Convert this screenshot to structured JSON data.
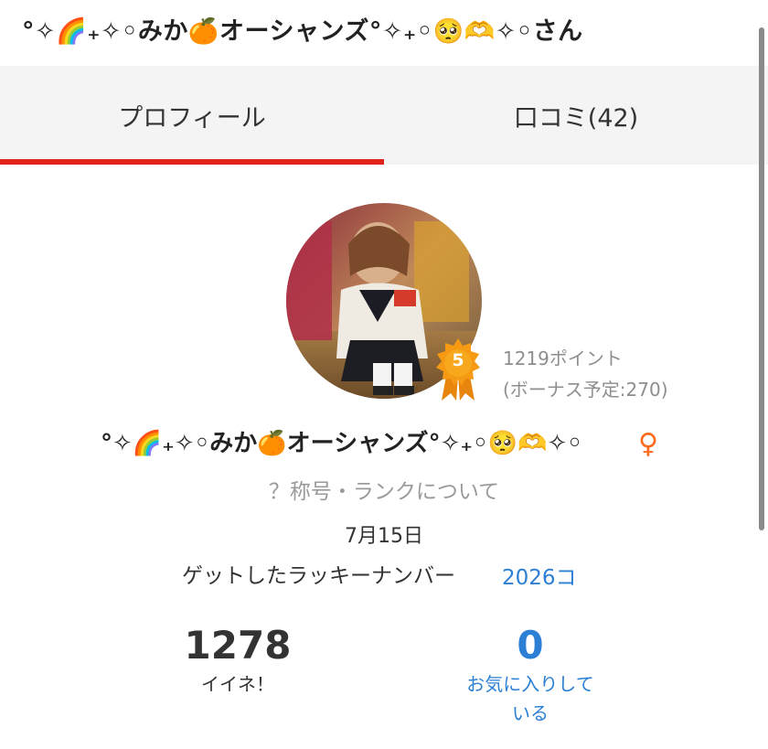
{
  "header": {
    "title": "°✧🌈₊✧◦みか🍊オーシャンズ°✧₊◦🥺🫶✧◦さん"
  },
  "tabs": [
    {
      "label": "プロフィール",
      "active": true
    },
    {
      "label": "口コミ(42)",
      "active": false
    }
  ],
  "profile": {
    "rank": "5",
    "points": "1219ポイント",
    "bonus": "(ボーナス予定:270)",
    "name": "°✧🌈₊✧◦みか🍊オーシャンズ°✧₊◦🥺🫶✧◦",
    "gender_symbol": "♀",
    "rank_link": "？称号・ランクについて",
    "lucky_date": "7月15日",
    "lucky_label": "ゲットしたラッキーナンバー",
    "lucky_count": "2026コ",
    "likes_value": "1278",
    "likes_label": "イイネ！",
    "favorites_value": "0",
    "favorites_label": "お気に入りしている"
  },
  "colors": {
    "accent_red": "#e0241b",
    "link_blue": "#2b7fd4",
    "badge_orange": "#f59a12",
    "gender_orange": "#ff6a1a",
    "muted_gray": "#8e8e8e"
  }
}
